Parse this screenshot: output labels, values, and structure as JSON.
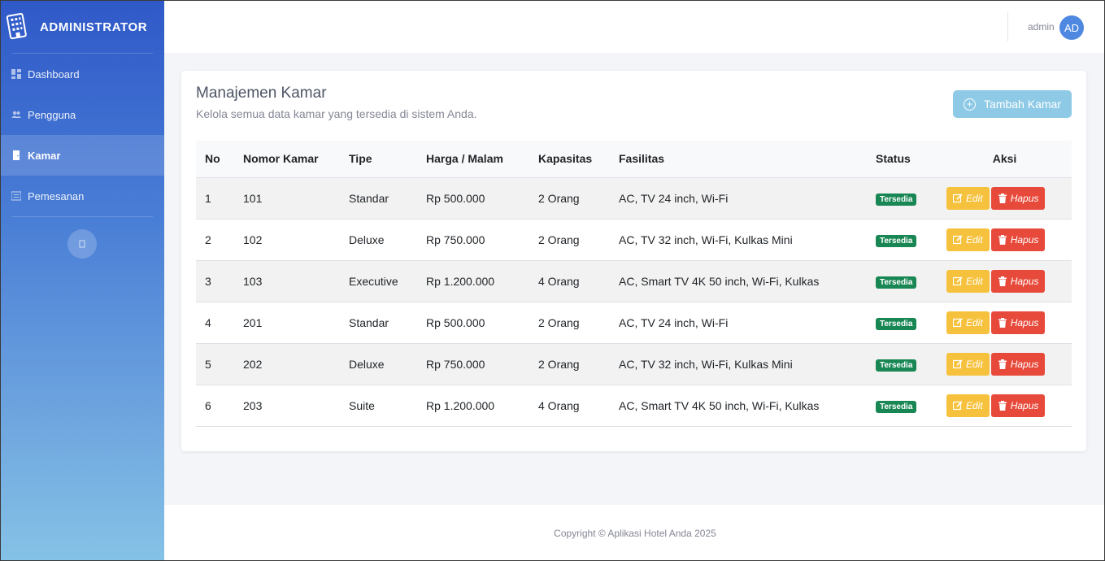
{
  "sidebar": {
    "brand": "ADMINISTRATOR",
    "items": [
      {
        "label": "Dashboard",
        "icon": "dashboard-icon"
      },
      {
        "label": "Pengguna",
        "icon": "users-icon"
      },
      {
        "label": "Kamar",
        "icon": "door-icon",
        "active": true
      },
      {
        "label": "Pemesanan",
        "icon": "list-icon"
      }
    ]
  },
  "topbar": {
    "user_name": "admin",
    "avatar_initials": "AD"
  },
  "page": {
    "title": "Manajemen Kamar",
    "subtitle": "Kelola semua data kamar yang tersedia di sistem Anda.",
    "add_button": "Tambah Kamar"
  },
  "table": {
    "headers": [
      "No",
      "Nomor Kamar",
      "Tipe",
      "Harga / Malam",
      "Kapasitas",
      "Fasilitas",
      "Status",
      "Aksi"
    ],
    "edit_label": "Edit",
    "delete_label": "Hapus",
    "rows": [
      {
        "no": "1",
        "nomor": "101",
        "tipe": "Standar",
        "harga": "Rp 500.000",
        "kapasitas": "2 Orang",
        "fasilitas": "AC, TV 24 inch, Wi-Fi",
        "status": "Tersedia"
      },
      {
        "no": "2",
        "nomor": "102",
        "tipe": "Deluxe",
        "harga": "Rp 750.000",
        "kapasitas": "2 Orang",
        "fasilitas": "AC, TV 32 inch, Wi-Fi, Kulkas Mini",
        "status": "Tersedia"
      },
      {
        "no": "3",
        "nomor": "103",
        "tipe": "Executive",
        "harga": "Rp 1.200.000",
        "kapasitas": "4 Orang",
        "fasilitas": "AC, Smart TV 4K 50 inch, Wi-Fi, Kulkas",
        "status": "Tersedia"
      },
      {
        "no": "4",
        "nomor": "201",
        "tipe": "Standar",
        "harga": "Rp 500.000",
        "kapasitas": "2 Orang",
        "fasilitas": "AC, TV 24 inch, Wi-Fi",
        "status": "Tersedia"
      },
      {
        "no": "5",
        "nomor": "202",
        "tipe": "Deluxe",
        "harga": "Rp 750.000",
        "kapasitas": "2 Orang",
        "fasilitas": "AC, TV 32 inch, Wi-Fi, Kulkas Mini",
        "status": "Tersedia"
      },
      {
        "no": "6",
        "nomor": "203",
        "tipe": "Suite",
        "harga": "Rp 1.200.000",
        "kapasitas": "4 Orang",
        "fasilitas": "AC, Smart TV 4K 50 inch, Wi-Fi, Kulkas",
        "status": "Tersedia"
      }
    ]
  },
  "footer": {
    "text": "Copyright © Aplikasi Hotel Anda 2025"
  },
  "colors": {
    "sidebar_top": "#2f59c8",
    "sidebar_bottom": "#85c2e6",
    "badge": "#198754",
    "edit": "#f6c23e",
    "delete": "#e74a3b",
    "add_button": "#8ecae6"
  }
}
